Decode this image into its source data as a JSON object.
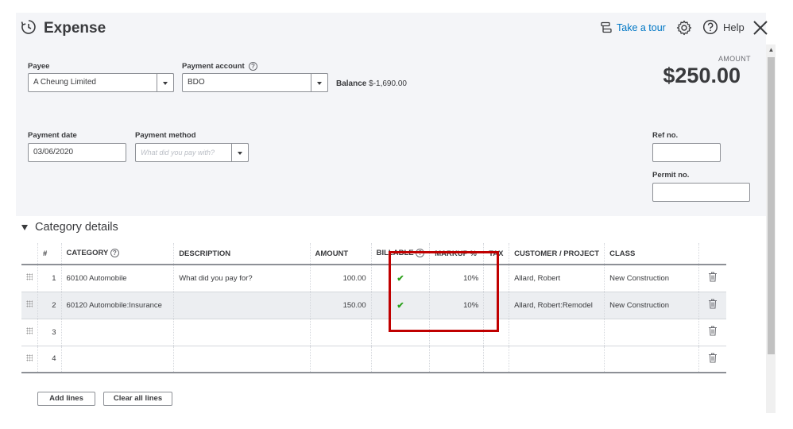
{
  "header": {
    "title": "Expense",
    "tour_label": "Take a tour",
    "help_label": "Help",
    "amount_label": "AMOUNT",
    "amount_value": "$250.00"
  },
  "form": {
    "payee": {
      "label": "Payee",
      "value": "A Cheung Limited"
    },
    "payment_account": {
      "label": "Payment account",
      "value": "BDO",
      "help": "?"
    },
    "balance": {
      "label": "Balance",
      "value": "$-1,690.00"
    },
    "payment_date": {
      "label": "Payment date",
      "value": "03/06/2020"
    },
    "payment_method": {
      "label": "Payment method",
      "placeholder": "What did you pay with?"
    },
    "ref_no": {
      "label": "Ref no.",
      "value": ""
    },
    "permit_no": {
      "label": "Permit no.",
      "value": ""
    }
  },
  "category_details": {
    "title": "Category details",
    "columns": [
      "#",
      "CATEGORY",
      "DESCRIPTION",
      "AMOUNT",
      "BILLABLE",
      "MARKUP %",
      "TAX",
      "CUSTOMER / PROJECT",
      "CLASS"
    ],
    "rows": [
      {
        "num": "1",
        "category": "60100 Automobile",
        "description": "",
        "description_placeholder": "What did you pay for?",
        "amount": "100.00",
        "billable": "✔",
        "markup": "10%",
        "tax": "",
        "customer": "Allard, Robert",
        "class": "New Construction"
      },
      {
        "num": "2",
        "category": "60120 Automobile:Insurance",
        "description": "",
        "description_placeholder": "",
        "amount": "150.00",
        "billable": "✔",
        "markup": "10%",
        "tax": "",
        "customer": "Allard, Robert:Remodel",
        "class": "New Construction"
      },
      {
        "num": "3",
        "category": "",
        "description": "",
        "description_placeholder": "",
        "amount": "",
        "billable": "",
        "markup": "",
        "tax": "",
        "customer": "",
        "class": ""
      },
      {
        "num": "4",
        "category": "",
        "description": "",
        "description_placeholder": "",
        "amount": "",
        "billable": "",
        "markup": "",
        "tax": "",
        "customer": "",
        "class": ""
      }
    ],
    "add_lines_label": "Add lines",
    "clear_lines_label": "Clear all lines"
  },
  "colors": {
    "accent": "#0077c5",
    "billable_check": "#2ca01c",
    "highlight_box": "#c00000",
    "panel_bg": "#f4f5f8"
  },
  "icons": [
    "expense-history-icon",
    "tour-icon",
    "gear-icon",
    "help-icon",
    "close-icon",
    "drag-handle-icon",
    "trash-icon",
    "collapse-triangle-icon"
  ]
}
